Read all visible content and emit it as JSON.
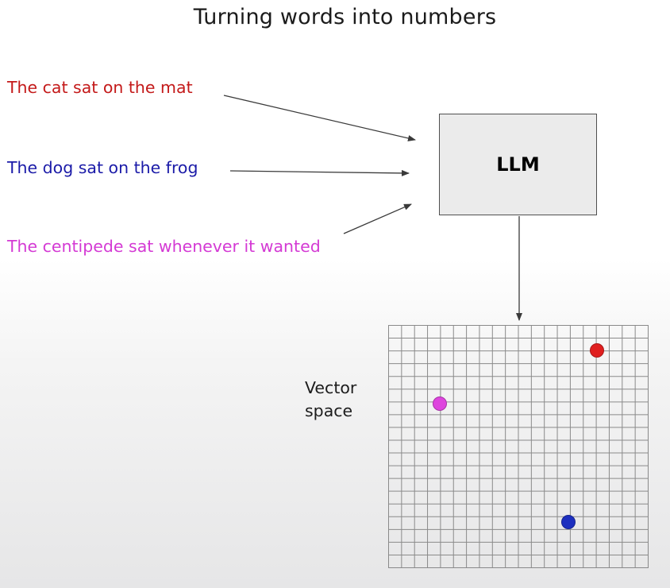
{
  "title": "Turning words into numbers",
  "sentences": [
    {
      "text": "The cat sat on the mat",
      "color": "#c41a1a"
    },
    {
      "text": "The dog sat on the frog",
      "color": "#1b1ba8"
    },
    {
      "text": "The centipede sat whenever it wanted",
      "color": "#d43ad4"
    }
  ],
  "llm": {
    "label": "LLM"
  },
  "vector_space": {
    "label_line1": "Vector",
    "label_line2": "space",
    "dots": [
      {
        "name": "red-dot",
        "color": "#e01f1f"
      },
      {
        "name": "pink-dot",
        "color": "#de45de"
      },
      {
        "name": "blue-dot",
        "color": "#1d2fbf"
      }
    ]
  }
}
